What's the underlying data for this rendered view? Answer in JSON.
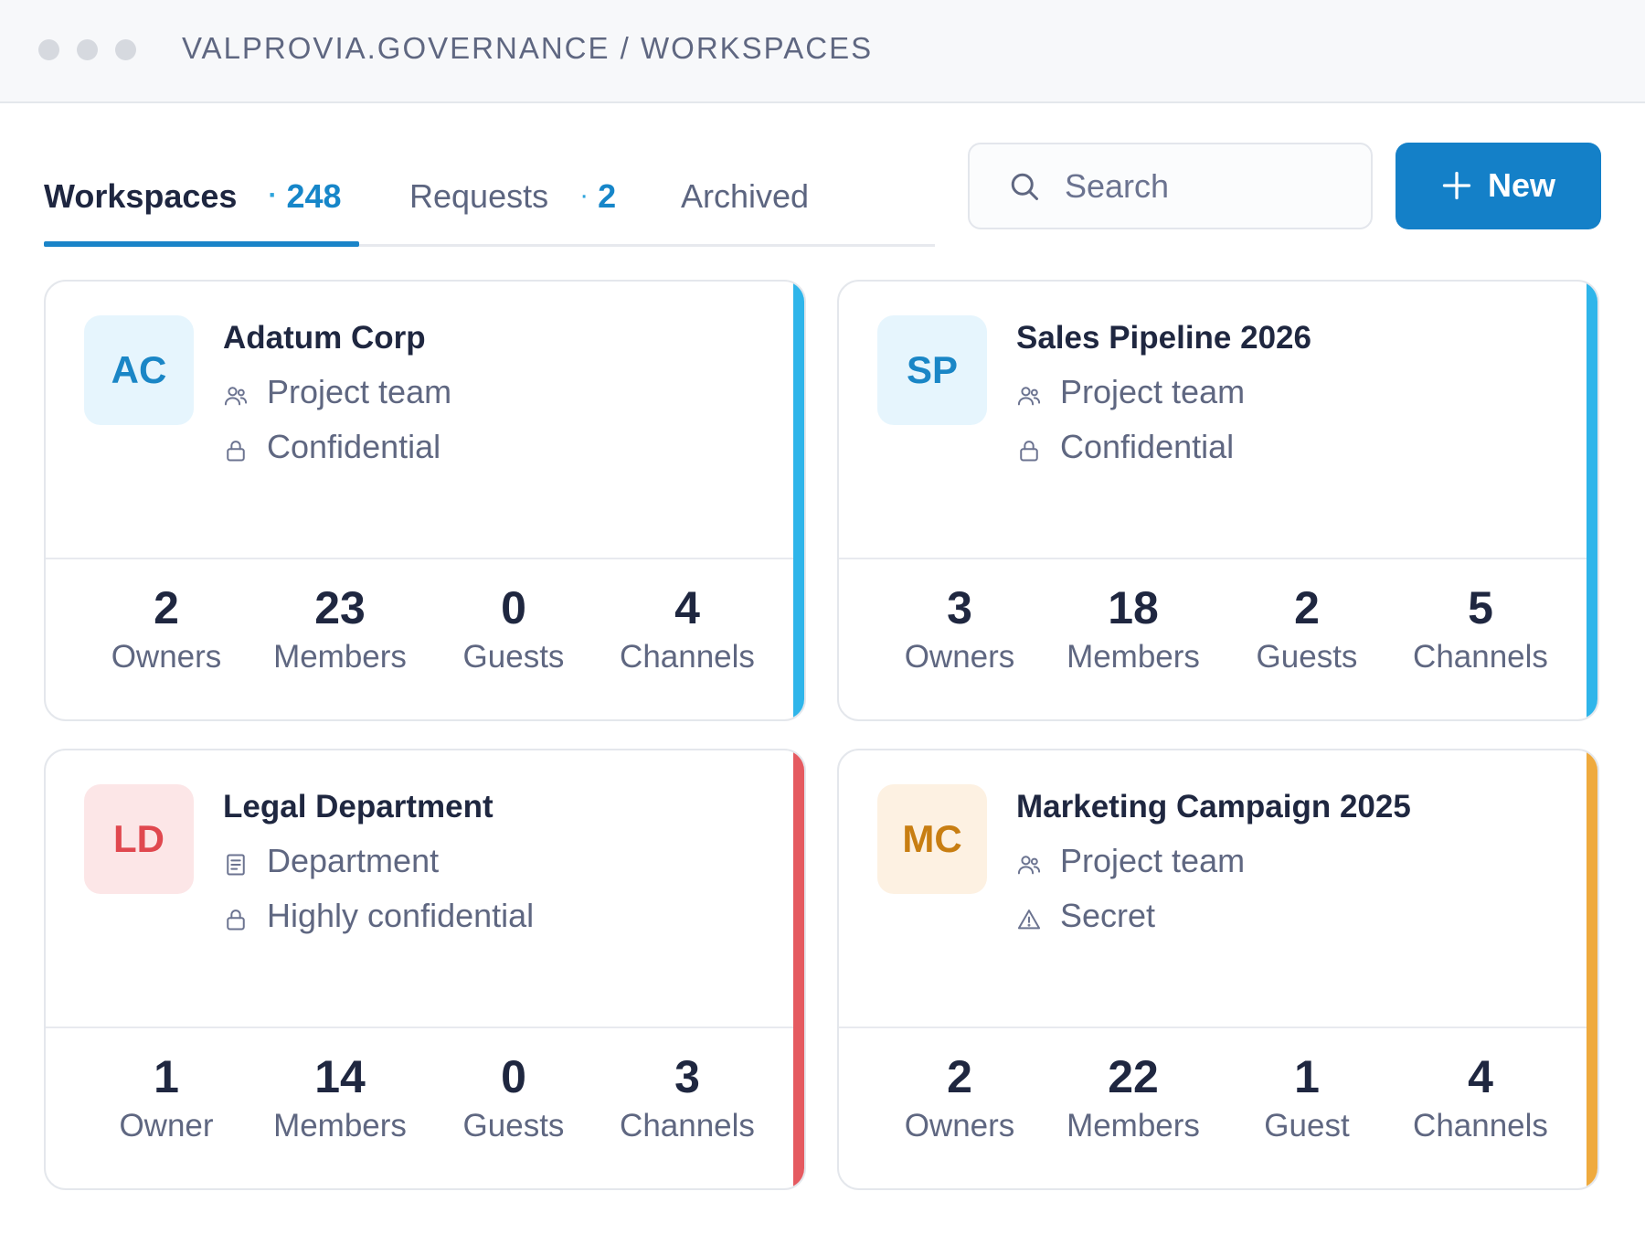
{
  "titlebar": {
    "breadcrumb": "VALPROVIA.GOVERNANCE / WORKSPACES"
  },
  "tabs": [
    {
      "label": "Workspaces",
      "count": "248",
      "active": true
    },
    {
      "label": "Requests",
      "count": "2",
      "active": false
    },
    {
      "label": "Archived",
      "active": false
    }
  ],
  "tab_separator": "·",
  "search": {
    "placeholder": "Search",
    "icon": "search-icon"
  },
  "new_button": {
    "label": "New",
    "icon": "plus-icon"
  },
  "cards": [
    {
      "initials": "AC",
      "title": "Adatum Corp",
      "type": {
        "icon": "people-icon",
        "label": "Project team"
      },
      "sensitivity": {
        "icon": "lock-icon",
        "label": "Confidential"
      },
      "stats": [
        {
          "value": "2",
          "label": "Owners"
        },
        {
          "value": "23",
          "label": "Members"
        },
        {
          "value": "0",
          "label": "Guests"
        },
        {
          "value": "4",
          "label": "Channels"
        }
      ],
      "colors": {
        "accent": "#2fb5ea",
        "avatar_bg": "#e6f5fd",
        "avatar_fg": "#1a86c6"
      }
    },
    {
      "initials": "SP",
      "title": "Sales Pipeline 2026",
      "type": {
        "icon": "people-icon",
        "label": "Project team"
      },
      "sensitivity": {
        "icon": "lock-icon",
        "label": "Confidential"
      },
      "stats": [
        {
          "value": "3",
          "label": "Owners"
        },
        {
          "value": "18",
          "label": "Members"
        },
        {
          "value": "2",
          "label": "Guests"
        },
        {
          "value": "5",
          "label": "Channels"
        }
      ],
      "colors": {
        "accent": "#2fb5ea",
        "avatar_bg": "#e6f5fd",
        "avatar_fg": "#1a86c6"
      }
    },
    {
      "initials": "LD",
      "title": "Legal Department",
      "type": {
        "icon": "document-icon",
        "label": "Department"
      },
      "sensitivity": {
        "icon": "lock-icon",
        "label": "Highly confidential"
      },
      "stats": [
        {
          "value": "1",
          "label": "Owner"
        },
        {
          "value": "14",
          "label": "Members"
        },
        {
          "value": "0",
          "label": "Guests"
        },
        {
          "value": "3",
          "label": "Channels"
        }
      ],
      "colors": {
        "accent": "#e55a60",
        "avatar_bg": "#fce6e7",
        "avatar_fg": "#e0484f"
      }
    },
    {
      "initials": "MC",
      "title": "Marketing Campaign 2025",
      "type": {
        "icon": "people-icon",
        "label": "Project team"
      },
      "sensitivity": {
        "icon": "warning-icon",
        "label": "Secret"
      },
      "stats": [
        {
          "value": "2",
          "label": "Owners"
        },
        {
          "value": "22",
          "label": "Members"
        },
        {
          "value": "1",
          "label": "Guest"
        },
        {
          "value": "4",
          "label": "Channels"
        }
      ],
      "colors": {
        "accent": "#efaa3e",
        "avatar_bg": "#fdf1e2",
        "avatar_fg": "#c87e12"
      }
    }
  ]
}
